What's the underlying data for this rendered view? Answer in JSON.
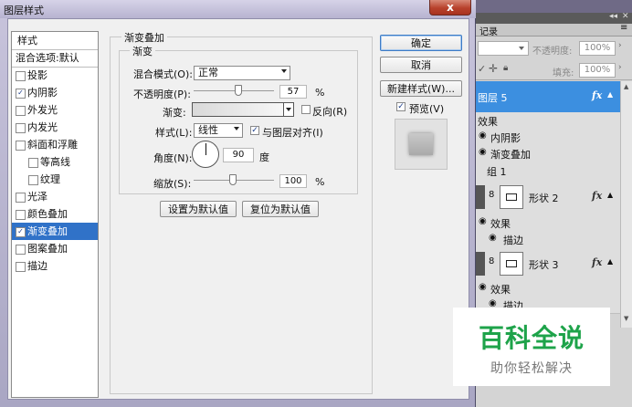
{
  "dialog": {
    "title": "图层样式",
    "close_glyph": "x"
  },
  "style_list": {
    "header": "样式",
    "items": [
      {
        "label": "混合选项:默认",
        "check": false,
        "checked": false,
        "selected": false,
        "indent": false
      },
      {
        "label": "投影",
        "check": true,
        "checked": false,
        "selected": false,
        "indent": false
      },
      {
        "label": "内阴影",
        "check": true,
        "checked": true,
        "selected": false,
        "indent": false
      },
      {
        "label": "外发光",
        "check": true,
        "checked": false,
        "selected": false,
        "indent": false
      },
      {
        "label": "内发光",
        "check": true,
        "checked": false,
        "selected": false,
        "indent": false
      },
      {
        "label": "斜面和浮雕",
        "check": true,
        "checked": false,
        "selected": false,
        "indent": false
      },
      {
        "label": "等高线",
        "check": true,
        "checked": false,
        "selected": false,
        "indent": true
      },
      {
        "label": "纹理",
        "check": true,
        "checked": false,
        "selected": false,
        "indent": true
      },
      {
        "label": "光泽",
        "check": true,
        "checked": false,
        "selected": false,
        "indent": false
      },
      {
        "label": "颜色叠加",
        "check": true,
        "checked": false,
        "selected": false,
        "indent": false
      },
      {
        "label": "渐变叠加",
        "check": true,
        "checked": true,
        "selected": true,
        "indent": false
      },
      {
        "label": "图案叠加",
        "check": true,
        "checked": false,
        "selected": false,
        "indent": false
      },
      {
        "label": "描边",
        "check": true,
        "checked": false,
        "selected": false,
        "indent": false
      }
    ]
  },
  "gradient_overlay": {
    "group_title": "渐变叠加",
    "subgroup_title": "渐变",
    "blend_mode_label": "混合模式(O):",
    "blend_mode_value": "正常",
    "opacity_label": "不透明度(P):",
    "opacity_value": "57",
    "opacity_fraction": 0.57,
    "percent_sign": "%",
    "gradient_label": "渐变:",
    "reverse_label": "反向(R)",
    "reverse_checked": false,
    "style_label": "样式(L):",
    "style_value": "线性",
    "align_label": "与图层对齐(I)",
    "align_checked": true,
    "angle_label": "角度(N):",
    "angle_value": "90",
    "angle_unit": "度",
    "scale_label": "缩放(S):",
    "scale_value": "100",
    "scale_fraction": 0.5,
    "make_default_button": "设置为默认值",
    "reset_default_button": "复位为默认值"
  },
  "buttons": {
    "ok": "确定",
    "cancel": "取消",
    "new_style": "新建样式(W)...",
    "preview_label": "预览(V)",
    "preview_checked": true
  },
  "layers_panel": {
    "tab_history": "记录",
    "opacity_label": "不透明度:",
    "opacity_value": "100%",
    "fill_label": "填充:",
    "fill_value": "100%",
    "selected_layer": "图层 5",
    "fx": "fx",
    "effects_label": "效果",
    "effect_inner_shadow": "内阴影",
    "effect_gradient_overlay": "渐变叠加",
    "group_name": "组 1",
    "layer_shape2": "形状 2",
    "layer_shape3": "形状 3",
    "effect_stroke": "描边",
    "selected_color": "#3c8fe0"
  },
  "watermark": {
    "title": "百科全说",
    "subtitle": "助你轻松解决",
    "title_color": "#1ea34a"
  }
}
